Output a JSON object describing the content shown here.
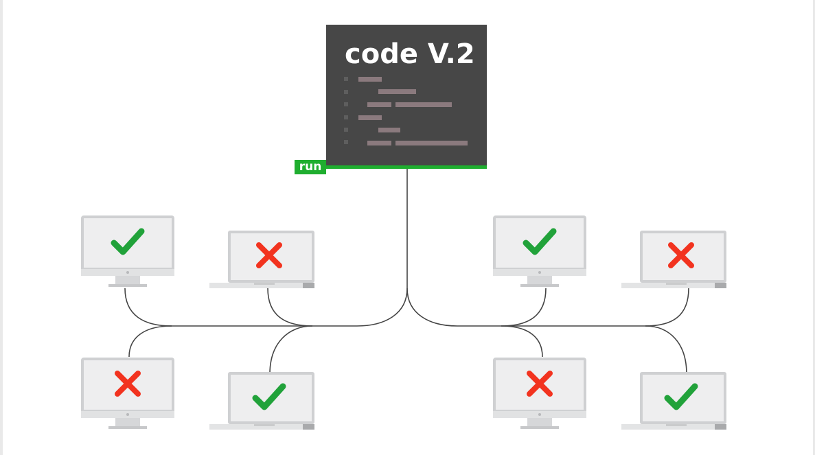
{
  "panel": {
    "title": "code V.2",
    "run_label": "run",
    "colors": {
      "panel_bg": "#474747",
      "run_green": "#1fae2f",
      "code_line": "#8b7a7e"
    }
  },
  "devices": [
    {
      "kind": "monitor",
      "status": "check"
    },
    {
      "kind": "laptop",
      "status": "cross"
    },
    {
      "kind": "monitor",
      "status": "cross"
    },
    {
      "kind": "laptop",
      "status": "check"
    },
    {
      "kind": "monitor",
      "status": "check"
    },
    {
      "kind": "laptop",
      "status": "cross"
    },
    {
      "kind": "monitor",
      "status": "cross"
    },
    {
      "kind": "laptop",
      "status": "check"
    }
  ],
  "colors": {
    "check": "#21a23a",
    "cross": "#f2331f",
    "device_frame": "#cfd0d2",
    "device_screen": "#eeeeef",
    "wire": "#444444"
  }
}
